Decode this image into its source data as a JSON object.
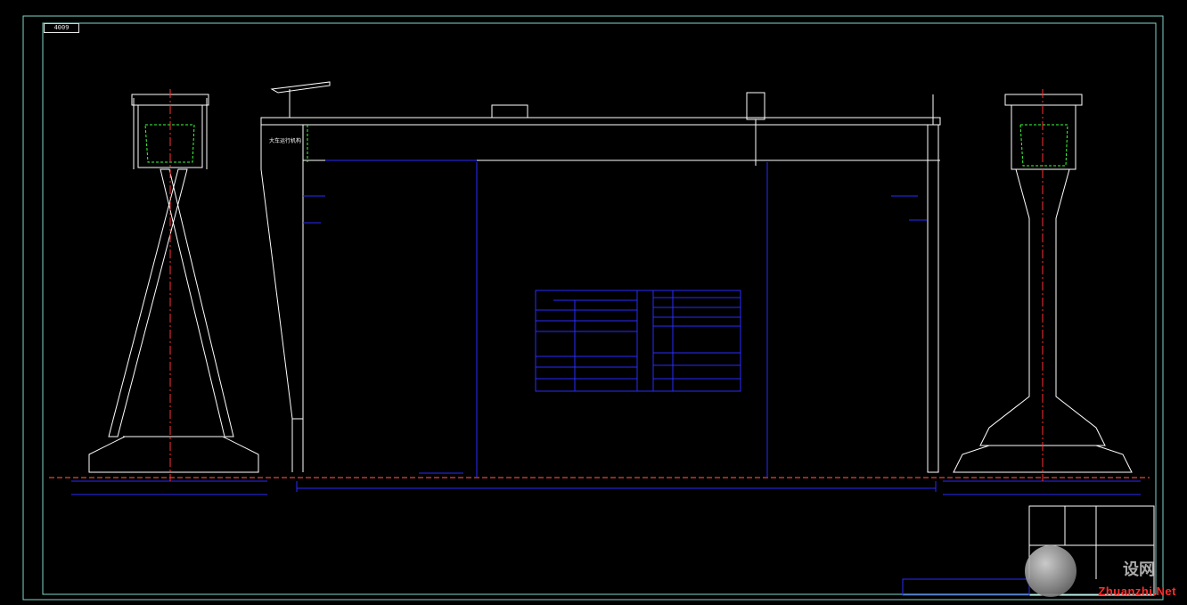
{
  "drawing": {
    "sheet_tag": "4009",
    "label_on_girder": "大车运行机构"
  },
  "colors": {
    "background": "#000000",
    "outline": "#ffffff",
    "border": "#7fd6c8",
    "dimension": "#2a2aff",
    "hidden": "#3cff3c",
    "ground": "#c03a2a"
  },
  "watermark": {
    "site": "Zhuanzhi.Net",
    "chinese": "设网",
    "logo_icon": "network-globe-icon"
  }
}
